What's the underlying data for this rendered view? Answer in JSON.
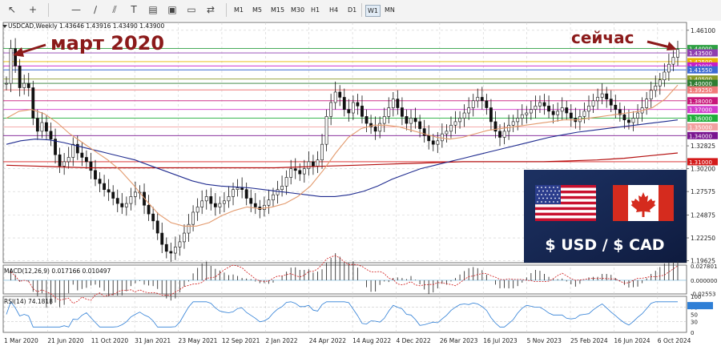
{
  "toolbar": {
    "icons": [
      "cursor-icon",
      "crosshair-icon",
      "hline-icon",
      "trendline-icon",
      "equidistant-channel-icon",
      "text-label-icon",
      "shapes-icon",
      "color-square-icon",
      "arrows-icon"
    ],
    "timeframes": [
      "M1",
      "M5",
      "M15",
      "M30",
      "H1",
      "H4",
      "D1",
      "W1",
      "MN"
    ]
  },
  "chart": {
    "symbol_info": "USDCAD,Weekly  1.43646 1.43916 1.43490 1.43900",
    "annotation_left": "март 2020",
    "annotation_right": "сейчас",
    "flag_banner_text": "$ USD / $ CAD",
    "macd_label": "MACD(12,26,9) 0.017166 0.010497",
    "rsi_label": "RSI(14) 74.1818"
  },
  "chart_data": {
    "type": "candlestick",
    "symbol": "USDCAD",
    "timeframe": "Weekly",
    "last_ohlc": {
      "open": 1.43646,
      "high": 1.43916,
      "low": 1.4349,
      "close": 1.439
    },
    "x_tick_labels": [
      "1 Mar 2020",
      "21 Jun 2020",
      "11 Oct 2020",
      "31 Jan 2021",
      "23 May 2021",
      "12 Sep 2021",
      "2 Jan 2022",
      "24 Apr 2022",
      "14 Aug 2022",
      "4 Dec 2022",
      "26 Mar 2023",
      "16 Jul 2023",
      "5 Nov 2023",
      "25 Feb 2024",
      "16 Jun 2024",
      "6 Oct 2024"
    ],
    "y_ticks": [
      "1.46100",
      "1.32825",
      "1.30200",
      "1.27575",
      "1.24875",
      "1.22250",
      "1.19625"
    ],
    "y_range": [
      1.194,
      1.47
    ],
    "level_labels": [
      {
        "value": "1.44000",
        "color": "#2ea043"
      },
      {
        "value": "1.43500",
        "color": "#8f3fb0"
      },
      {
        "value": "1.42500",
        "color": "#e8b400"
      },
      {
        "value": "1.42000",
        "color": "#c81ec8"
      },
      {
        "value": "1.41550",
        "color": "#3d6bd4"
      },
      {
        "value": "1.40500",
        "color": "#8a9a28"
      },
      {
        "value": "1.40000",
        "color": "#2e7d32"
      },
      {
        "value": "1.39250",
        "color": "#f07a7a"
      },
      {
        "value": "1.38000",
        "color": "#c8167a"
      },
      {
        "value": "1.37000",
        "color": "#d23ccc"
      },
      {
        "value": "1.36000",
        "color": "#1fae3a"
      },
      {
        "value": "1.35000",
        "color": "#f2a0a0"
      },
      {
        "value": "1.34000",
        "color": "#7a1590"
      },
      {
        "value": "1.31000",
        "color": "#d41a1a"
      }
    ],
    "close_series": [
      1.4,
      1.44,
      1.42,
      1.395,
      1.4,
      1.395,
      1.36,
      1.345,
      1.355,
      1.345,
      1.336,
      1.318,
      1.305,
      1.31,
      1.315,
      1.33,
      1.32,
      1.315,
      1.31,
      1.3,
      1.29,
      1.285,
      1.278,
      1.275,
      1.268,
      1.262,
      1.258,
      1.262,
      1.27,
      1.275,
      1.275,
      1.26,
      1.25,
      1.242,
      1.228,
      1.215,
      1.207,
      1.205,
      1.212,
      1.218,
      1.228,
      1.238,
      1.252,
      1.258,
      1.265,
      1.27,
      1.262,
      1.258,
      1.262,
      1.265,
      1.27,
      1.278,
      1.28,
      1.278,
      1.268,
      1.262,
      1.258,
      1.255,
      1.26,
      1.266,
      1.272,
      1.278,
      1.282,
      1.292,
      1.302,
      1.3,
      1.296,
      1.302,
      1.31,
      1.305,
      1.312,
      1.33,
      1.362,
      1.378,
      1.39,
      1.384,
      1.37,
      1.366,
      1.378,
      1.374,
      1.362,
      1.354,
      1.35,
      1.345,
      1.354,
      1.362,
      1.372,
      1.382,
      1.372,
      1.362,
      1.354,
      1.36,
      1.356,
      1.348,
      1.34,
      1.334,
      1.33,
      1.334,
      1.342,
      1.345,
      1.352,
      1.356,
      1.36,
      1.366,
      1.372,
      1.38,
      1.384,
      1.38,
      1.372,
      1.356,
      1.345,
      1.338,
      1.345,
      1.352,
      1.356,
      1.36,
      1.364,
      1.366,
      1.37,
      1.374,
      1.378,
      1.374,
      1.368,
      1.364,
      1.368,
      1.372,
      1.366,
      1.36,
      1.356,
      1.362,
      1.368,
      1.374,
      1.38,
      1.384,
      1.388,
      1.382,
      1.375,
      1.37,
      1.364,
      1.358,
      1.355,
      1.36,
      1.366,
      1.372,
      1.382,
      1.392,
      1.397,
      1.404,
      1.413,
      1.422,
      1.43,
      1.439
    ],
    "sma_fast": {
      "color": "#e39a6d",
      "values": [
        1.36,
        1.368,
        1.37,
        1.365,
        1.355,
        1.342,
        1.332,
        1.322,
        1.312,
        1.3,
        1.284,
        1.266,
        1.25,
        1.24,
        1.236,
        1.236,
        1.24,
        1.248,
        1.254,
        1.258,
        1.256,
        1.258,
        1.262,
        1.27,
        1.282,
        1.3,
        1.32,
        1.338,
        1.348,
        1.352,
        1.352,
        1.35,
        1.346,
        1.342,
        1.338,
        1.336,
        1.338,
        1.342,
        1.346,
        1.348,
        1.35,
        1.352,
        1.354,
        1.356,
        1.358,
        1.358,
        1.36,
        1.362,
        1.364,
        1.366,
        1.368,
        1.372,
        1.382,
        1.398
      ]
    },
    "sma_slow": {
      "color": "#1f2b8f",
      "values": [
        1.33,
        1.334,
        1.336,
        1.335,
        1.332,
        1.328,
        1.324,
        1.32,
        1.316,
        1.312,
        1.306,
        1.3,
        1.294,
        1.288,
        1.284,
        1.282,
        1.281,
        1.28,
        1.278,
        1.276,
        1.274,
        1.272,
        1.27,
        1.27,
        1.272,
        1.276,
        1.282,
        1.29,
        1.296,
        1.302,
        1.306,
        1.31,
        1.314,
        1.318,
        1.322,
        1.326,
        1.33,
        1.334,
        1.338,
        1.341,
        1.344,
        1.346,
        1.348,
        1.35,
        1.352,
        1.354,
        1.356,
        1.358
      ]
    },
    "sma_200": {
      "color": "#b40f0f",
      "values": [
        1.306,
        1.305,
        1.304,
        1.303,
        1.303,
        1.303,
        1.303,
        1.303,
        1.303,
        1.303,
        1.303,
        1.304,
        1.305,
        1.306,
        1.307,
        1.308,
        1.309,
        1.31,
        1.31,
        1.31,
        1.31,
        1.311,
        1.312,
        1.314,
        1.317,
        1.32
      ]
    },
    "macd": {
      "yticks": [
        "0.027801",
        "0.000000",
        "-0.02553"
      ],
      "range": [
        -0.026,
        0.029
      ]
    },
    "rsi": {
      "yticks": [
        "100",
        "70",
        "50",
        "30",
        "0"
      ],
      "range": [
        0,
        100
      ],
      "last": 74.18
    }
  }
}
